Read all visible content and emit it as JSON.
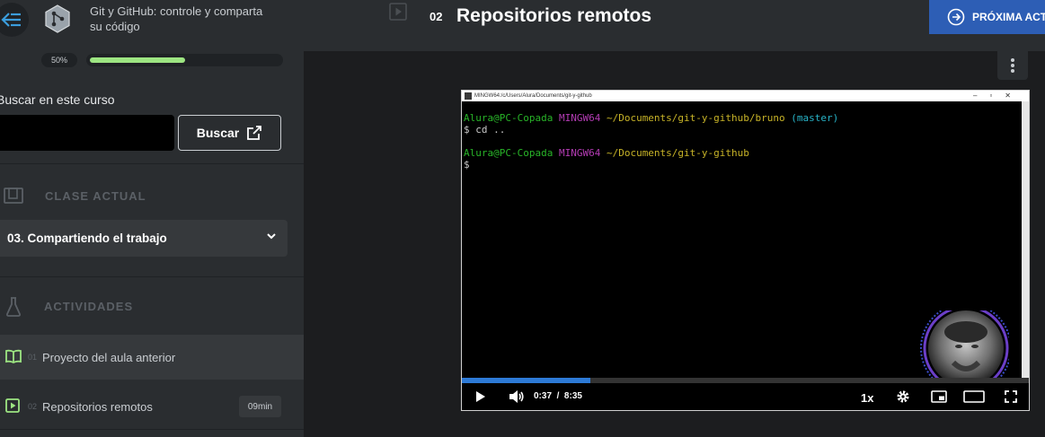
{
  "sidebar": {
    "course_title": "Git y GitHub: controle y comparta su código",
    "progress_label": "50%",
    "progress_fraction": 0.5,
    "search_label": "Buscar en este curso",
    "search_value": "",
    "search_button": "Buscar",
    "current_class_header": "CLASE ACTUAL",
    "current_class": "03. Compartiendo el trabajo",
    "activities_header": "ACTIVIDADES",
    "activities": [
      {
        "num": "01",
        "label": "Proyecto del aula anterior",
        "duration": "",
        "icon": "book-icon"
      },
      {
        "num": "02",
        "label": "Repositorios remotos",
        "duration": "09min",
        "icon": "video-icon"
      }
    ]
  },
  "header": {
    "lesson_num": "02",
    "lesson_title": "Repositorios remotos",
    "next_button": "PRÓXIMA ACT"
  },
  "player": {
    "window_title": "MINGW64:/c/Users/Alura/Documents/git-y-github",
    "terminal": {
      "line1_user": "Alura@PC-Copada",
      "line1_env": "MINGW64",
      "line1_path": "~/Documents/git-y-github/bruno",
      "line1_branch": "(master)",
      "line2": "$ cd ..",
      "line3_user": "Alura@PC-Copada",
      "line3_env": "MINGW64",
      "line3_path": "~/Documents/git-y-github",
      "line4": "$"
    },
    "current_time": "0:37",
    "separator": "/",
    "duration": "8:35",
    "played_fraction": 0.227,
    "speed": "1x"
  },
  "colors": {
    "accent_green": "#9de582",
    "next_blue": "#2d5eb5",
    "seek_blue": "#2d7ad6"
  }
}
